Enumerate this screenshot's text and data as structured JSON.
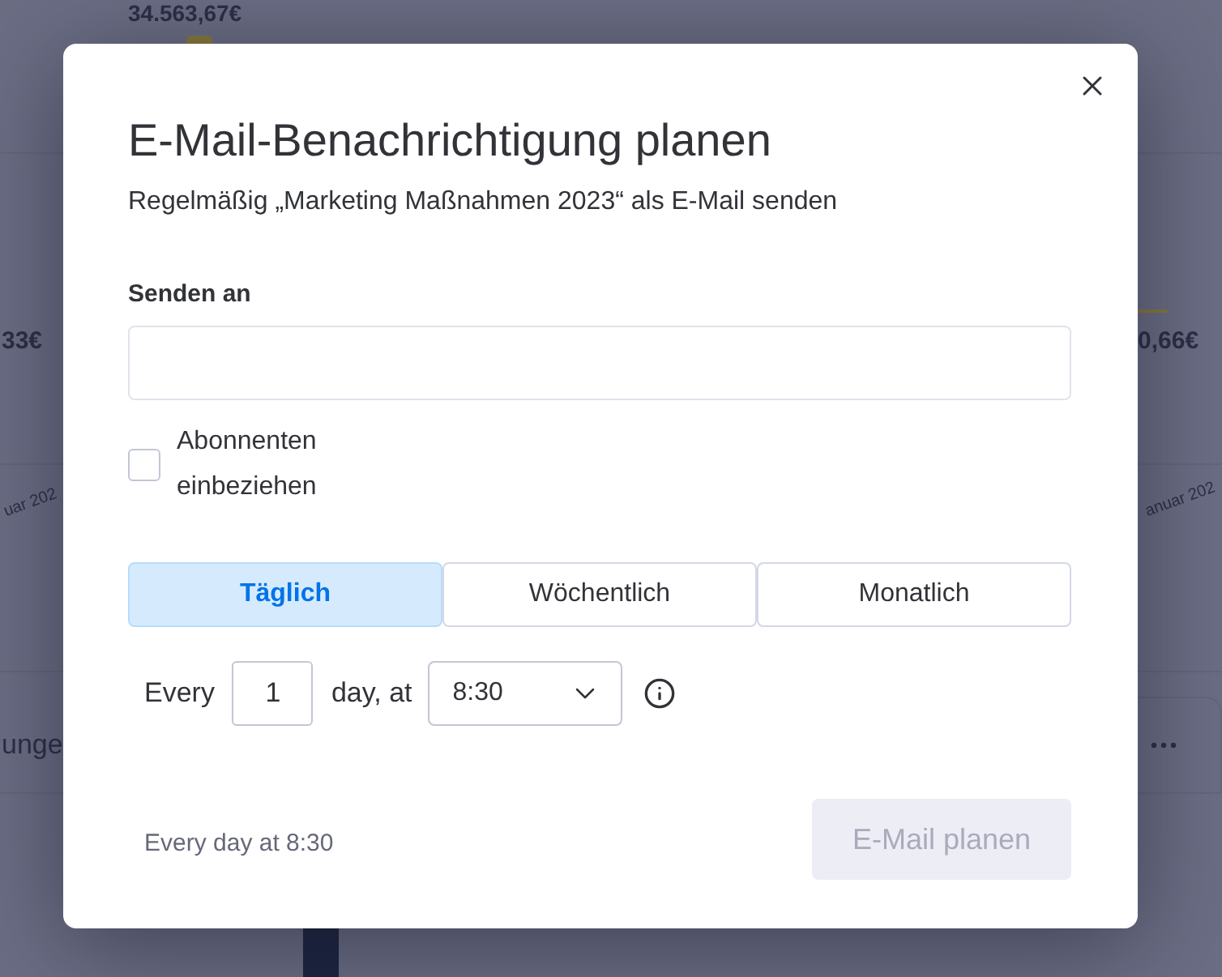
{
  "background": {
    "total_value": "34.563,67€",
    "left_value": "33€",
    "right_value": "0,66€",
    "left_axis_label": "uar 202",
    "right_axis_label": "anuar 202",
    "left_card_title": "unge"
  },
  "dialog": {
    "title": "E-Mail-Benachrichtigung planen",
    "subtitle": "Regelmäßig „Marketing Maßnahmen 2023“ als E-Mail senden",
    "recipients": {
      "label": "Senden an"
    },
    "include_subscribers": {
      "label": "Abonnenten einbeziehen",
      "checked": false
    },
    "frequency_tabs": [
      {
        "label": "Täglich",
        "selected": true
      },
      {
        "label": "Wöchentlich",
        "selected": false
      },
      {
        "label": "Monatlich",
        "selected": false
      }
    ],
    "schedule": {
      "prefix": "Every",
      "interval": "1",
      "unit_label": "day, at",
      "time": "8:30"
    },
    "summary": "Every day at 8:30",
    "submit": {
      "label": "E-Mail planen",
      "disabled": true
    }
  }
}
